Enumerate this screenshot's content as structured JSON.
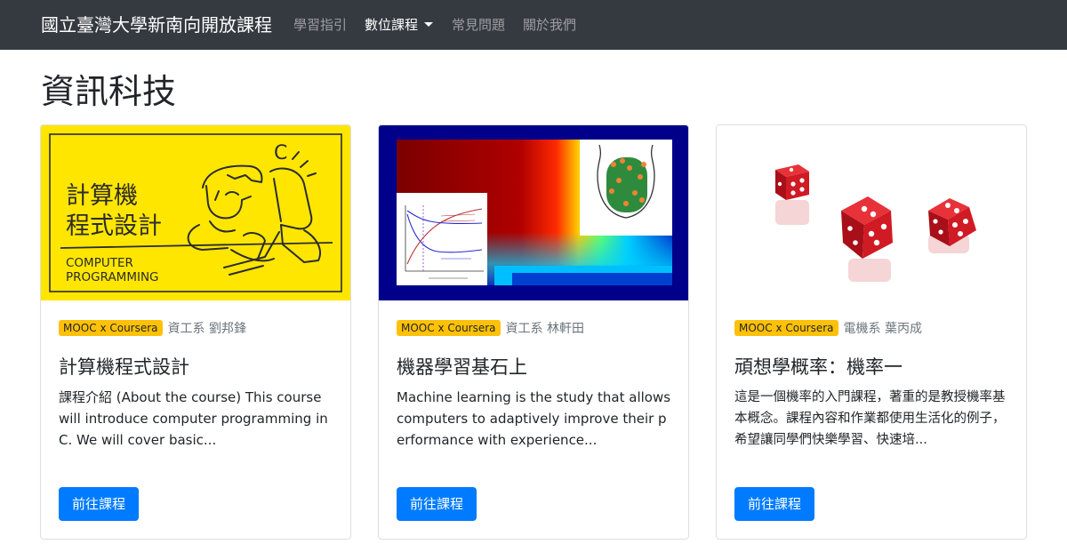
{
  "navbar": {
    "brand": "國立臺灣大學新南向開放課程",
    "links": [
      {
        "label": "學習指引"
      },
      {
        "label": "數位課程"
      },
      {
        "label": "常見問題"
      },
      {
        "label": "關於我們"
      }
    ]
  },
  "page": {
    "title": "資訊科技"
  },
  "courses": [
    {
      "badge": "MOOC x Coursera",
      "dept": "資工系 劉邦鋒",
      "title": "計算機程式設計",
      "description": "課程介紹 (About the course) This course will introduce computer programming in C. We will cover basic...",
      "button": "前往課程",
      "image_text": {
        "title_line1": "計算機",
        "title_line2": "程式設計",
        "en_line1": "COMPUTER",
        "en_line2": "PROGRAMMING",
        "glyph": "C"
      }
    },
    {
      "badge": "MOOC x Coursera",
      "dept": "資工系 林軒田",
      "title": "機器學習基石上",
      "description": "Machine learning is the study that allows computers to adaptively improve their performance with experience...",
      "button": "前往課程"
    },
    {
      "badge": "MOOC x Coursera",
      "dept": "電機系 葉丙成",
      "title": "頑想學概率：機率一",
      "description": "這是一個機率的入門課程，著重的是教授機率基本概念。課程內容和作業都使用生活化的例子，希望讓同學們快樂學習、快速培...",
      "button": "前往課程"
    }
  ],
  "colors": {
    "navbar": "#343a40",
    "badge": "#ffc107",
    "button": "#007bff",
    "programming_banner": "#ffe600"
  }
}
